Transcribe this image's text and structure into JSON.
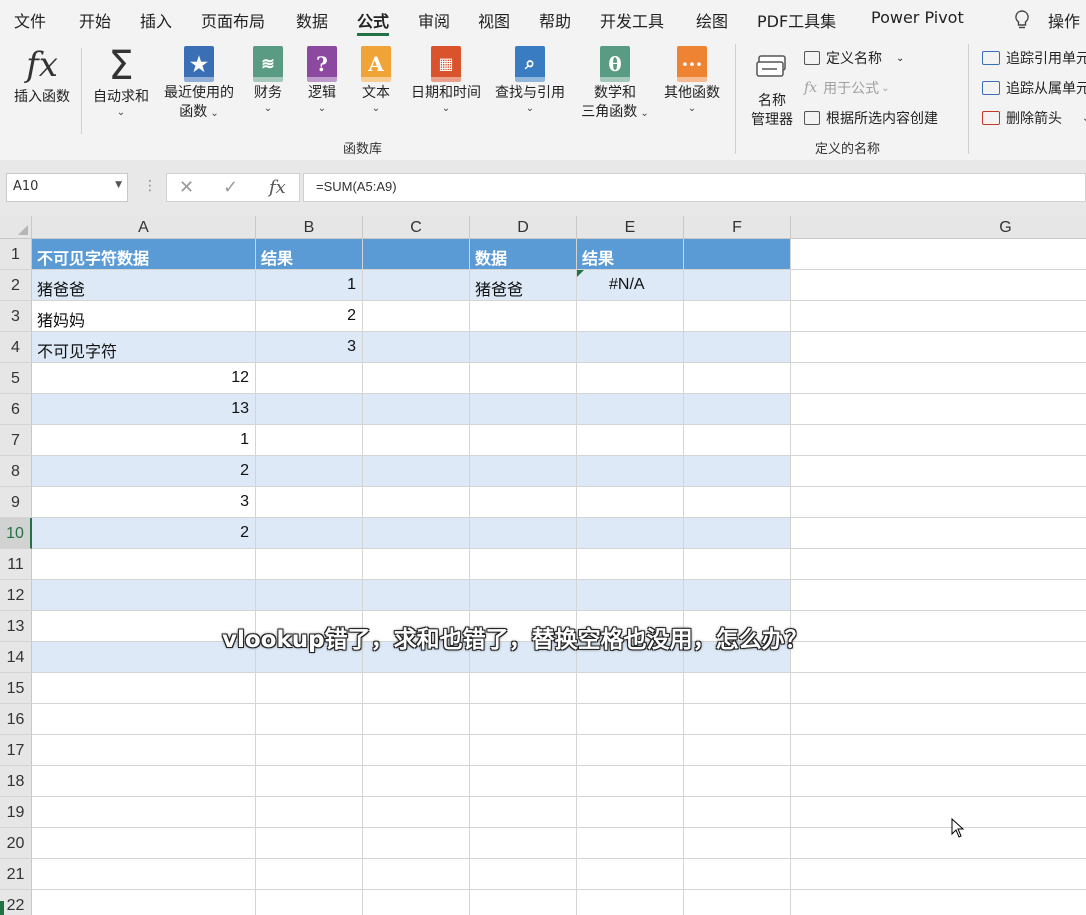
{
  "menu": {
    "tabs": [
      "文件",
      "开始",
      "插入",
      "页面布局",
      "数据",
      "公式",
      "审阅",
      "视图",
      "帮助",
      "开发工具",
      "绘图",
      "PDF工具集",
      "Power Pivot"
    ],
    "active": "公式",
    "search_label": "操作"
  },
  "ribbon": {
    "insert_function": "插入函数",
    "autosum": "自动求和",
    "recent_line1": "最近使用的",
    "recent_line2": "函数",
    "financial": "财务",
    "logical": "逻辑",
    "text": "文本",
    "datetime": "日期和时间",
    "lookup": "查找与引用",
    "math_line1": "数学和",
    "math_line2": "三角函数",
    "more": "其他函数",
    "group_library": "函数库",
    "name_manager_line1": "名称",
    "name_manager_line2": "管理器",
    "define_name": "定义名称",
    "use_in_formula": "用于公式",
    "create_from_selection": "根据所选内容创建",
    "group_names": "定义的名称",
    "trace_precedents": "追踪引用单元",
    "trace_dependents": "追踪从属单元",
    "remove_arrows": "删除箭头"
  },
  "formula_bar": {
    "name_box": "A10",
    "formula": "=SUM(A5:A9)",
    "fx_label": "fx"
  },
  "columns": [
    "A",
    "B",
    "C",
    "D",
    "E",
    "F",
    "G"
  ],
  "rows": [
    "1",
    "2",
    "3",
    "4",
    "5",
    "6",
    "7",
    "8",
    "9",
    "10",
    "11",
    "12",
    "13",
    "14",
    "15",
    "16",
    "17",
    "18",
    "19",
    "20",
    "21",
    "22"
  ],
  "cells": {
    "A1": "不可见字符数据",
    "B1": "结果",
    "D1": "数据",
    "E1": "结果",
    "A2": "猪爸爸",
    "B2": "1",
    "D2": "猪爸爸",
    "E2": "#N/A",
    "A3": "猪妈妈",
    "B3": "2",
    "A4": "不可见字符",
    "B4": "3",
    "A5": "12",
    "A6": "13",
    "A7": "1",
    "A8": "2",
    "A9": "3",
    "A10": "2"
  },
  "subtitle": "vlookup错了，求和也错了，替换空格也没用，怎么办？",
  "colors": {
    "accent": "#217346",
    "table_header": "#5b9bd5",
    "table_band": "#dde9f7"
  }
}
